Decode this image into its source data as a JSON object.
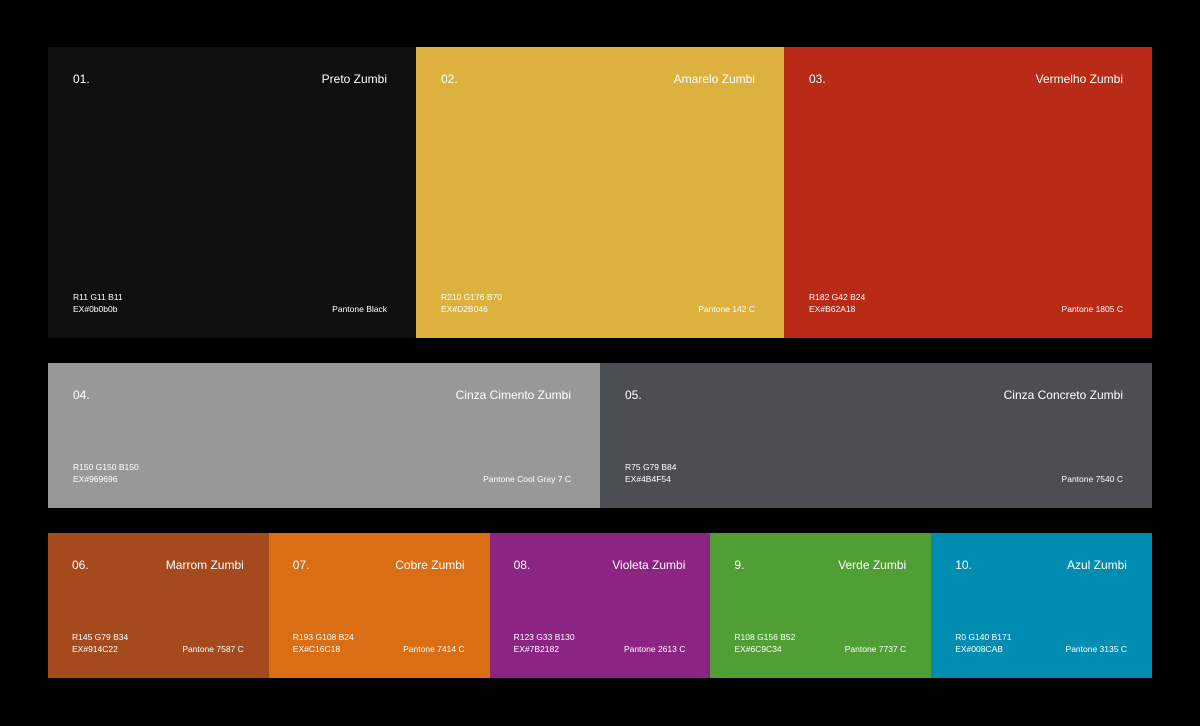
{
  "swatches": [
    {
      "num": "01.",
      "name": "Preto Zumbi",
      "rgb": "R11 G11 B11",
      "hex": "EX#0b0b0b",
      "pantone": "Pantone Black",
      "color": "#0F0F0B"
    },
    {
      "num": "02.",
      "name": "Amarelo Zumbi",
      "rgb": "R210 G176 B70",
      "hex": "EX#D2B046",
      "pantone": "Pantone 142 C",
      "color": "#DCB13D"
    },
    {
      "num": "03.",
      "name": "Vermelho Zumbi",
      "rgb": "R182 G42 B24",
      "hex": "EX#B62A18",
      "pantone": "Pantone 1805 C",
      "color": "#B92A17"
    },
    {
      "num": "04.",
      "name": "Cinza Cimento Zumbi",
      "rgb": "R150 G150 B150",
      "hex": "EX#969696",
      "pantone": "Pantone Cool Gray 7 C",
      "color": "#989898"
    },
    {
      "num": "05.",
      "name": "Cinza Concreto Zumbi",
      "rgb": "R75 G79 B84",
      "hex": "EX#4B4F54",
      "pantone": "Pantone 7540 C",
      "color": "#4B4F53"
    },
    {
      "num": "06.",
      "name": "Marrom Zumbi",
      "rgb": "R145 G79 B34",
      "hex": "EX#914C22",
      "pantone": "Pantone 7587 C",
      "color": "#A44A1D"
    },
    {
      "num": "07.",
      "name": "Cobre Zumbi",
      "rgb": "R193 G108 B24",
      "hex": "EX#C16C18",
      "pantone": "Pantone 7414 C",
      "color": "#DA6E14"
    },
    {
      "num": "08.",
      "name": "Violeta Zumbi",
      "rgb": "R123 G33 B130",
      "hex": "EX#7B2182",
      "pantone": "Pantone 2613 C",
      "color": "#8B2483"
    },
    {
      "num": "9.",
      "name": "Verde Zumbi",
      "rgb": "R108 G156 B52",
      "hex": "EX#6C9C34",
      "pantone": "Pantone 7737 C",
      "color": "#509F35"
    },
    {
      "num": "10.",
      "name": "Azul Zumbi",
      "rgb": "R0 G140 B171",
      "hex": "EX#008CAB",
      "pantone": "Pantone 3135 C",
      "color": "#008DB1"
    }
  ]
}
